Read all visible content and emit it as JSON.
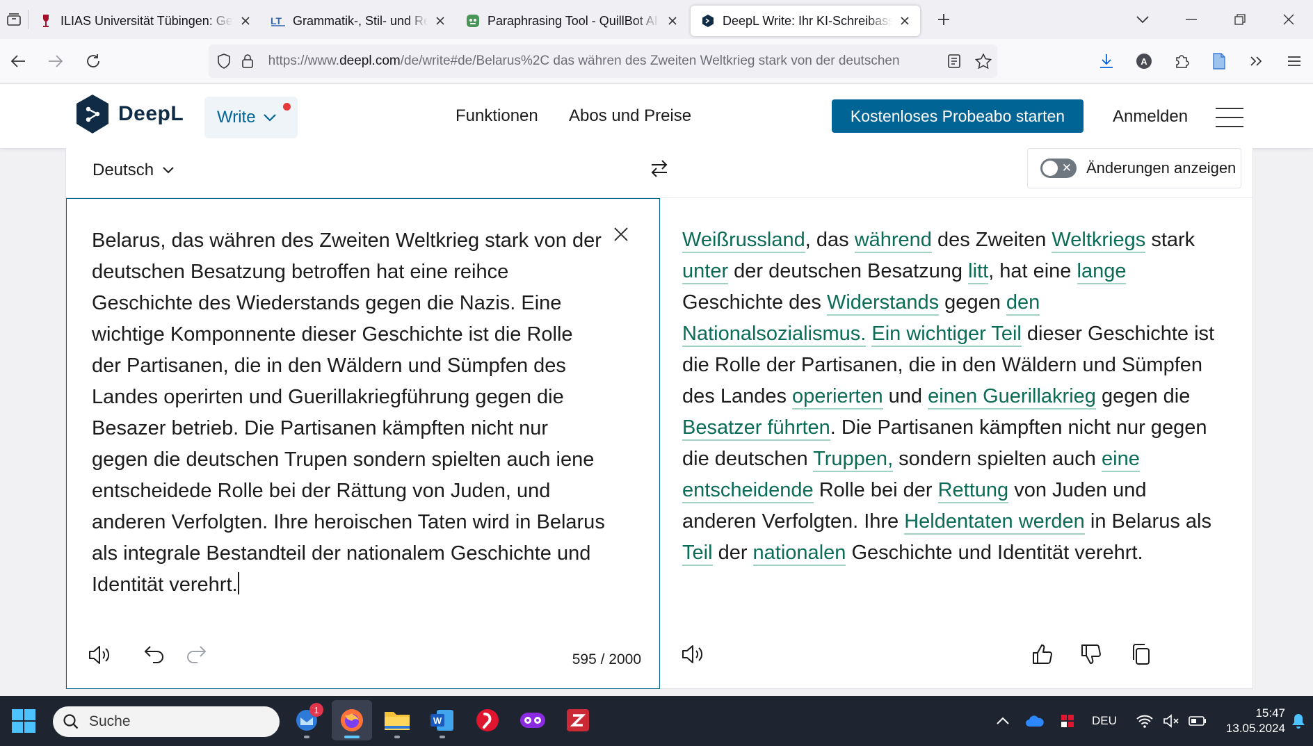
{
  "browser": {
    "tabs": [
      {
        "title": "ILIAS Universität Tübingen: Geschichte",
        "favicon": "ilias-icon",
        "favicon_color": "#a5102a",
        "active": false
      },
      {
        "title": "Grammatik-, Stil- und Rechtschreibprüfung",
        "favicon": "languagetool-icon",
        "favicon_color": "#3266b1",
        "active": false
      },
      {
        "title": "Paraphrasing Tool - QuillBot AI",
        "favicon": "quillbot-icon",
        "favicon_color": "#499557",
        "active": false
      },
      {
        "title": "DeepL Write: Ihr KI-Schreibassistent",
        "favicon": "deepl-icon",
        "favicon_color": "#0f2b46",
        "active": true
      }
    ],
    "url_prefix": "https://www.",
    "url_domain": "deepl.com",
    "url_rest": "/de/write#de/Belarus%2C das währen des Zweiten Weltkrieg stark von der deutschen"
  },
  "deepl": {
    "logo_text": "DeepL",
    "write_label": "Write",
    "nav": [
      "Funktionen",
      "Abos und Preise"
    ],
    "cta": "Kostenloses Probeabo starten",
    "login": "Anmelden",
    "language": "Deutsch",
    "toggle_label": "Änderungen anzeigen",
    "toggle_on": false,
    "source_text": "Belarus, das währen des Zweiten Weltkrieg stark von der deutschen Besatzung betroffen hat eine reihce Geschichte des Wiederstands gegen die Nazis. Eine wichtige Komponnente dieser Geschichte ist die Rolle der Partisanen, die in den Wäldern und Sümpfen des Landes operirten und Guerillakriegführung gegen die Besazer betrieb. Die Partisanen kämpften nicht nur gegen die deutschen Trupen sondern spielten auch iene entscheidede Rolle bei der Rättung von Juden, und anderen Verfolgten. Ihre heroischen Taten wird in Belarus als integrale Bestandteil der nationalem Geschichte und Identität verehrt.",
    "char_count": "595 / 2000",
    "target_segments": [
      {
        "t": "Weißrussland",
        "c": true
      },
      {
        "t": ", das ",
        "c": false
      },
      {
        "t": "während",
        "c": true
      },
      {
        "t": " des Zweiten ",
        "c": false
      },
      {
        "t": "Weltkriegs",
        "c": true
      },
      {
        "t": " stark ",
        "c": false
      },
      {
        "t": "unter",
        "c": true
      },
      {
        "t": " der deutschen Besatzung ",
        "c": false
      },
      {
        "t": "litt",
        "c": true
      },
      {
        "t": ", hat eine ",
        "c": false
      },
      {
        "t": "lange",
        "c": true
      },
      {
        "t": " Geschichte des ",
        "c": false
      },
      {
        "t": "Widerstands",
        "c": true
      },
      {
        "t": " gegen ",
        "c": false
      },
      {
        "t": "den Nationalsozialismus.",
        "c": true
      },
      {
        "t": " ",
        "c": false
      },
      {
        "t": "Ein wichtiger Teil",
        "c": true
      },
      {
        "t": " dieser Geschichte ist die Rolle der Partisanen, die in den Wäldern und Sümpfen des Landes ",
        "c": false
      },
      {
        "t": "operierten",
        "c": true
      },
      {
        "t": " und ",
        "c": false
      },
      {
        "t": "einen Guerillakrieg",
        "c": true
      },
      {
        "t": " gegen die ",
        "c": false
      },
      {
        "t": "Besatzer führten",
        "c": true
      },
      {
        "t": ". Die Partisanen kämpften nicht nur gegen die deutschen ",
        "c": false
      },
      {
        "t": "Truppen,",
        "c": true
      },
      {
        "t": " sondern spielten auch ",
        "c": false
      },
      {
        "t": "eine entscheidende",
        "c": true
      },
      {
        "t": " Rolle bei der ",
        "c": false
      },
      {
        "t": "Rettung",
        "c": true
      },
      {
        "t": " von Juden und anderen Verfolgten. Ihre ",
        "c": false
      },
      {
        "t": "Heldentaten werden",
        "c": true
      },
      {
        "t": " in Belarus als ",
        "c": false
      },
      {
        "t": "Teil",
        "c": true
      },
      {
        "t": " der ",
        "c": false
      },
      {
        "t": "nationalen",
        "c": true
      },
      {
        "t": " Geschichte und Identität verehrt.",
        "c": false
      }
    ]
  },
  "taskbar": {
    "search_label": "Suche",
    "apps": [
      {
        "name": "mail-app-icon",
        "badge": "1",
        "active": false
      },
      {
        "name": "firefox-icon",
        "badge": null,
        "active": true
      },
      {
        "name": "file-explorer-icon",
        "badge": null,
        "active": false
      },
      {
        "name": "word-icon",
        "badge": null,
        "active": false
      },
      {
        "name": "opera-icon",
        "badge": null,
        "active": false
      },
      {
        "name": "privacy-mask-icon",
        "badge": null,
        "active": false
      },
      {
        "name": "zotero-icon",
        "badge": null,
        "active": false
      }
    ],
    "language": "DEU",
    "time": "15:47",
    "date": "13.05.2024"
  },
  "colors": {
    "accent": "#006494",
    "change_text": "#0a6b56",
    "change_underline": "#9fd2c5",
    "taskbar": "#1e2430"
  }
}
